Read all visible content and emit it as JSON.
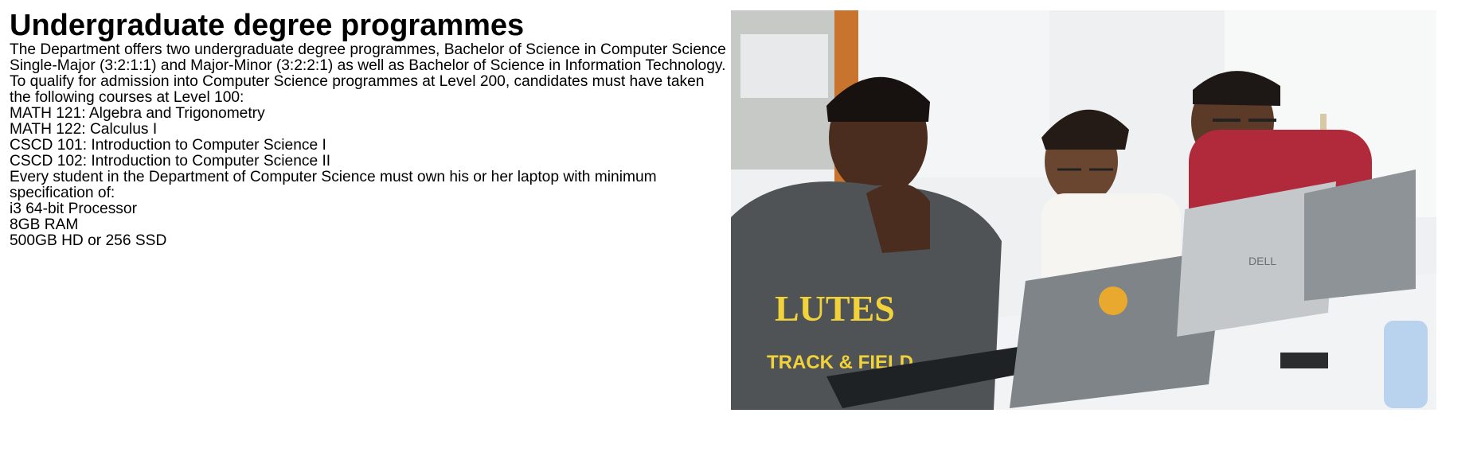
{
  "page": {
    "title": "Undergraduate degree programmes",
    "intro": "The Department offers two undergraduate degree programmes, Bachelor of Science in Computer Science Single-Major (3:2:1:1) and Major-Minor (3:2:2:1) as well as Bachelor of Science in Information Technology. To qualify for admission into Computer Science programmes at Level 200, candidates must have taken the following courses at Level 100:",
    "courses": [
      "MATH 121: Algebra and Trigonometry",
      "MATH 122: Calculus I",
      "CSCD 101: Introduction to Computer Science I",
      "CSCD 102: Introduction to Computer Science II"
    ],
    "laptop_note": "Every student in the Department of Computer Science must own his or her laptop with minimum specification of:",
    "specs": [
      "i3 64-bit Processor",
      "8GB RAM",
      "500GB HD or 256 SSD"
    ]
  },
  "photo": {
    "shirt_print": "LUTES",
    "shirt_print_2": "TRACK & FIELD",
    "laptop_brand": "DELL"
  }
}
